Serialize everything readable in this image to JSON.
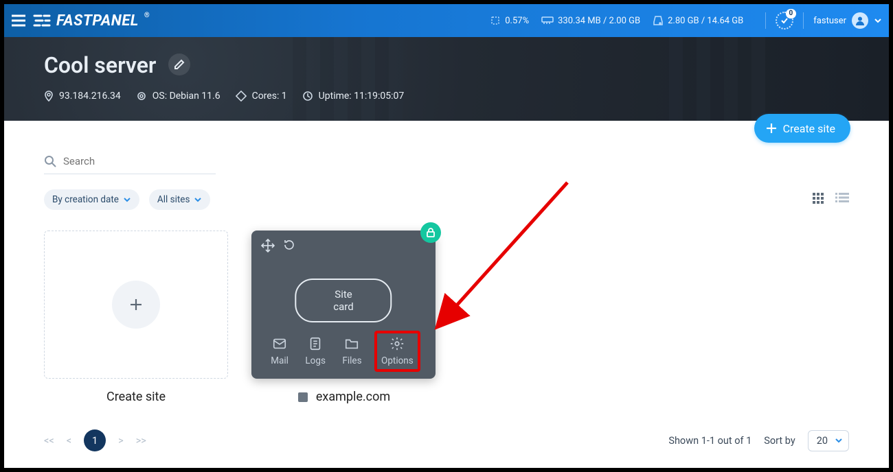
{
  "brand": "FASTPANEL",
  "topbar": {
    "cpu": "0.57%",
    "ram": "330.34 MB / 2.00 GB",
    "disk": "2.80 GB / 14.64 GB",
    "tasks_badge": "0",
    "username": "fastuser"
  },
  "hero": {
    "title": "Cool server",
    "ip": "93.184.216.34",
    "os": "OS: Debian 11.6",
    "cores": "Cores: 1",
    "uptime": "Uptime: 11:19:05:07"
  },
  "buttons": {
    "create_site": "Create site"
  },
  "search": {
    "placeholder": "Search"
  },
  "filters": {
    "sort": "By creation date",
    "scope": "All sites"
  },
  "cards": {
    "create_label": "Create site",
    "site_card_button": "Site card",
    "site_domain": "example.com",
    "actions": {
      "mail": "Mail",
      "logs": "Logs",
      "files": "Files",
      "options": "Options"
    }
  },
  "footer": {
    "first": "<<",
    "prev": "<",
    "page": "1",
    "next": ">",
    "last": ">>",
    "shown": "Shown 1-1 out of 1",
    "sort_by_label": "Sort by",
    "page_size": "20"
  }
}
